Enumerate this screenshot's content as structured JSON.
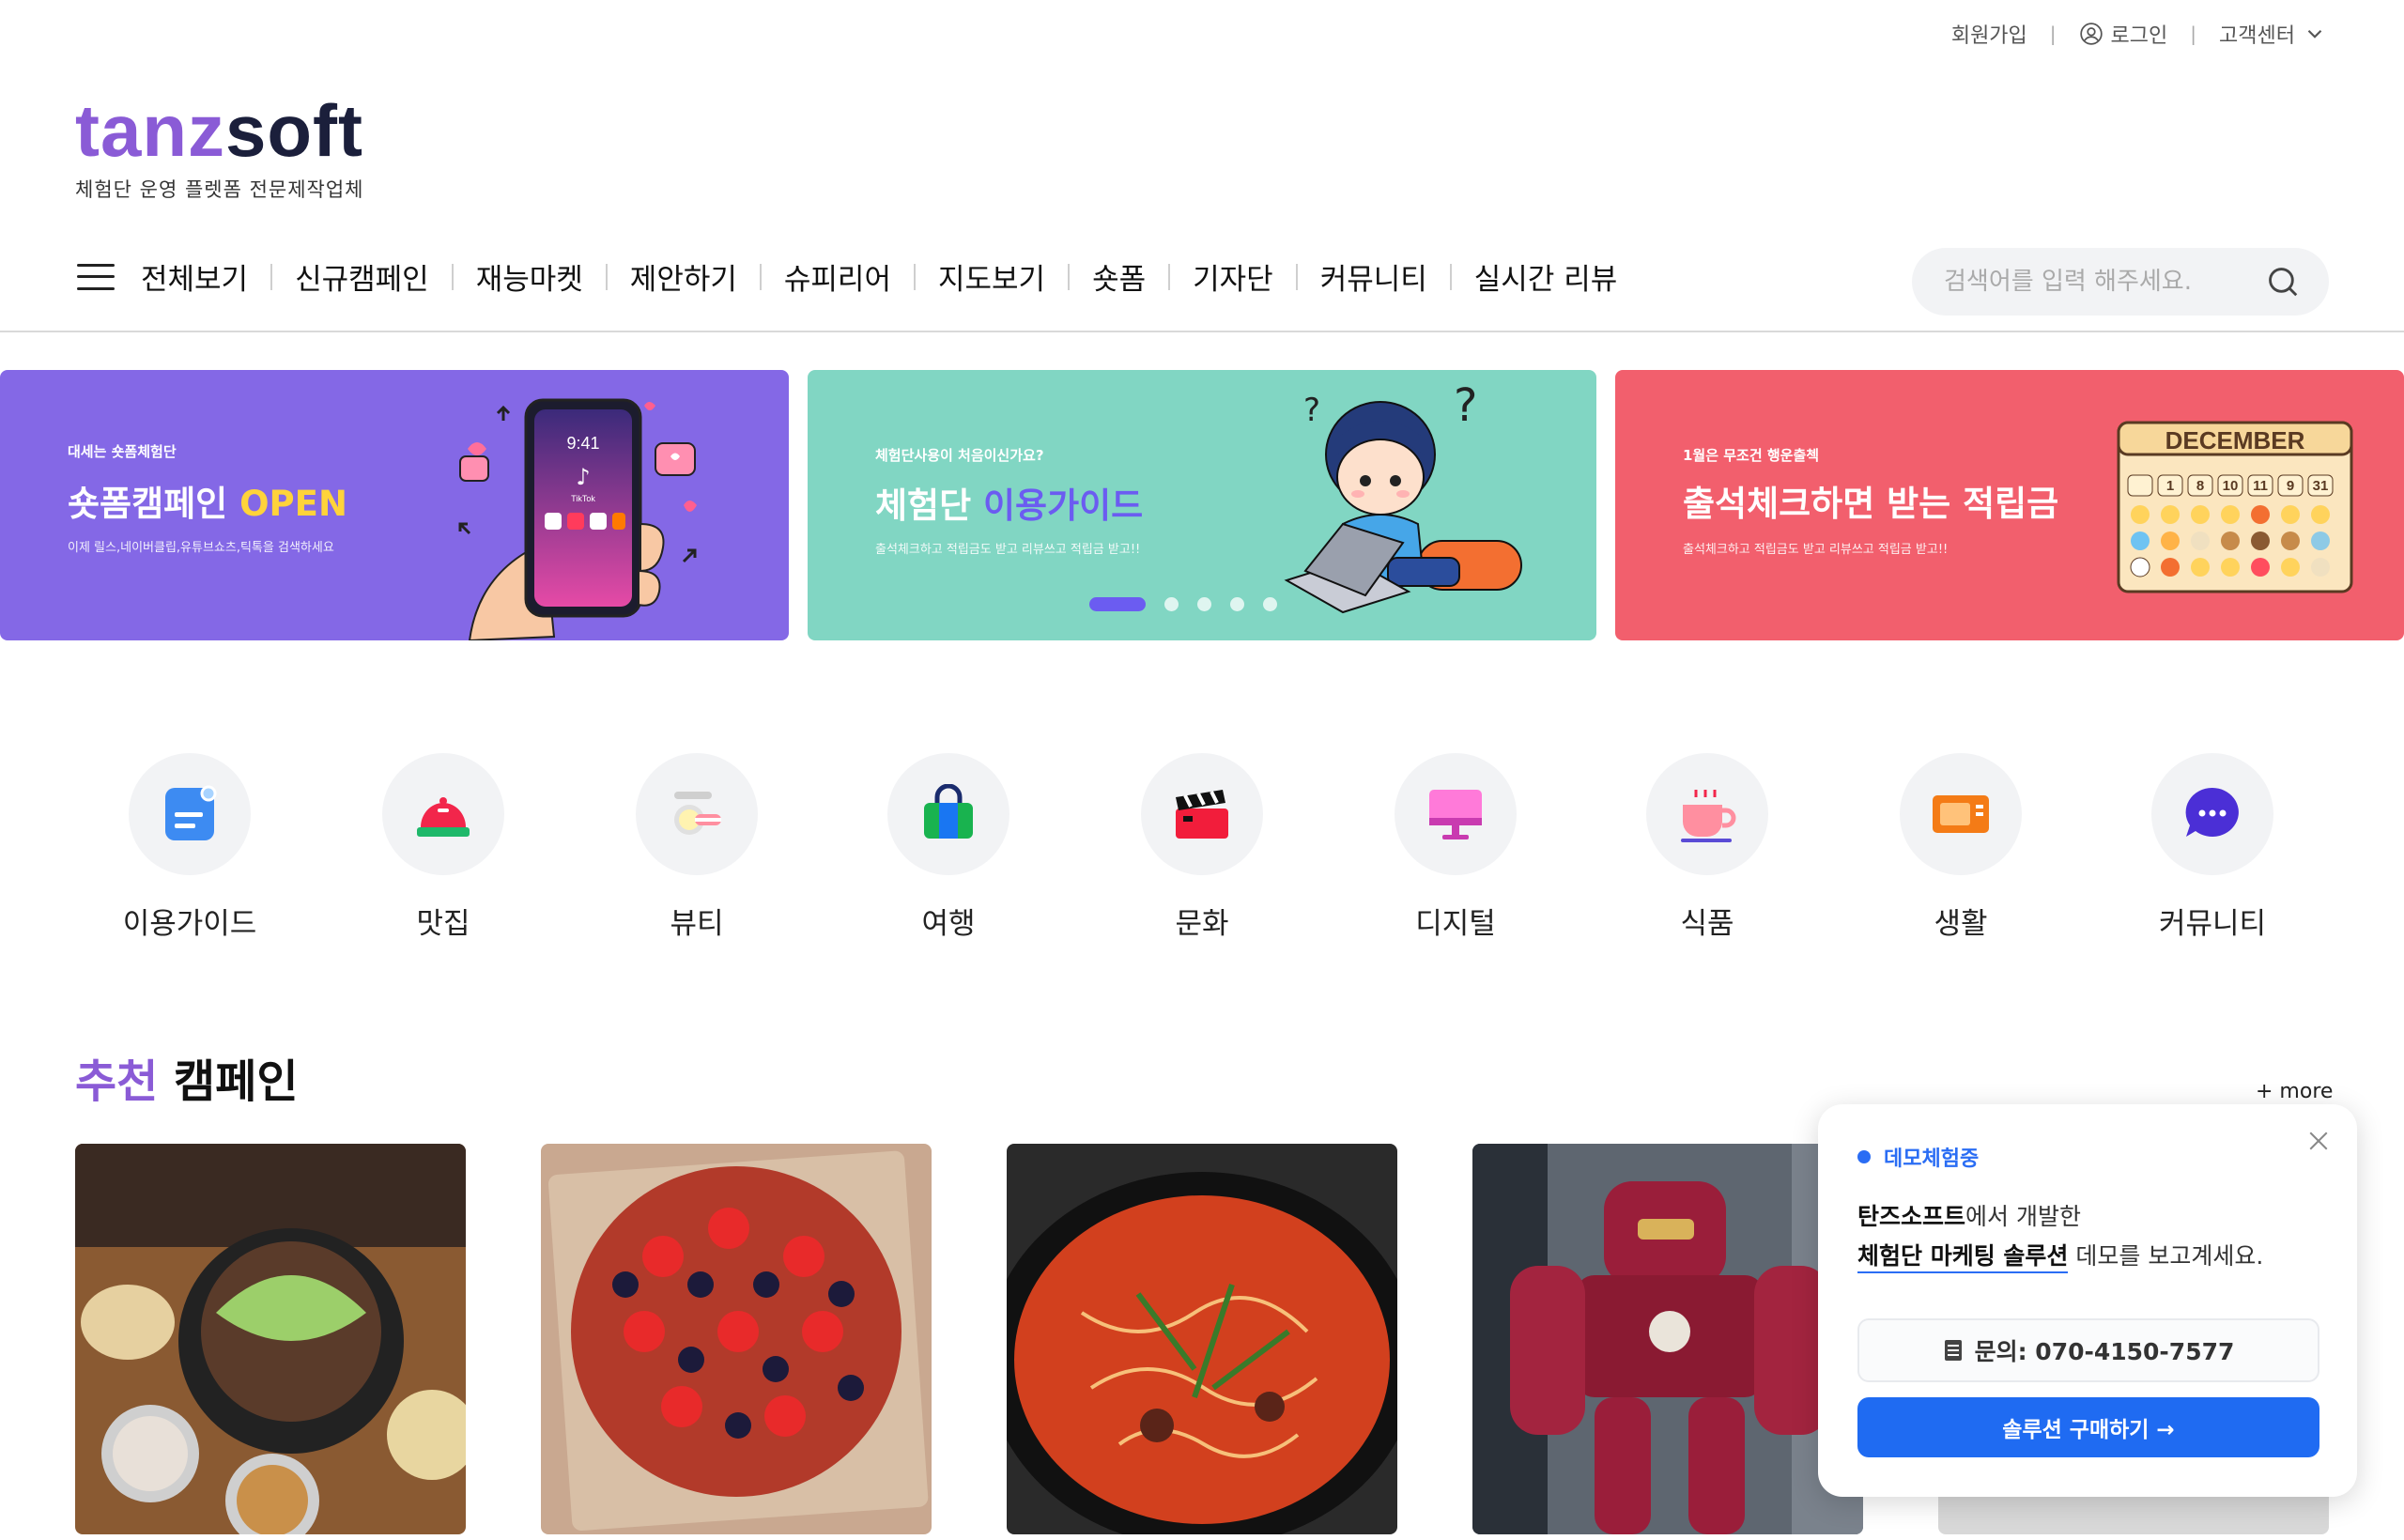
{
  "util": {
    "signup": "회원가입",
    "login": "로그인",
    "support": "고객센터"
  },
  "logo": {
    "part1": "tanz",
    "part2": "soft",
    "subtitle": "체험단 운영 플렛폼 전문제작업체"
  },
  "nav": {
    "items": [
      "전체보기",
      "신규캠페인",
      "재능마켓",
      "제안하기",
      "슈피리어",
      "지도보기",
      "숏폼",
      "기자단",
      "커뮤니티",
      "실시간 리뷰"
    ]
  },
  "search": {
    "placeholder": "검색어를 입력 해주세요."
  },
  "banners": [
    {
      "small": "대세는 숏폼체험단",
      "title": "숏폼캠페인 ",
      "title_accent": "OPEN",
      "desc": "이제 릴스,네이버클립,유튜브쇼츠,틱톡을 검색하세요",
      "phone_time": "9:41",
      "phone_app": "TikTok"
    },
    {
      "small": "체험단사용이 처음이신가요?",
      "title": "체험단 ",
      "title_accent": "이용가이드",
      "desc": "출석체크하고 적립금도 받고 리뷰쓰고 적립금 받고!!"
    },
    {
      "small": "1월은 무조건 행운출첵",
      "title": "출석체크하면 받는 적립금",
      "desc": "출석체크하고 적립금도 받고 리뷰쓰고 적립금 받고!!",
      "calendar_month": "DECEMBER",
      "calendar_nums": [
        "1",
        "8",
        "10",
        "11",
        "9",
        "31"
      ]
    }
  ],
  "slider": {
    "count": 5,
    "active": 1
  },
  "categories": [
    "이용가이드",
    "맛집",
    "뷰티",
    "여행",
    "문화",
    "디지털",
    "식품",
    "생활",
    "커뮤니티"
  ],
  "recommend": {
    "title_accent": "추천",
    "title_rest": " 캠페인",
    "more": "+ more"
  },
  "popup": {
    "badge": "데모체험중",
    "line1_bold": "탄즈소프트",
    "line1_rest": "에서 개발한",
    "line2_bold": "체험단 마케팅 솔루션",
    "line2_rest": " 데모를 보고계세요.",
    "contact": "문의: 070-4150-7577",
    "buy": "솔루션 구매하기 →"
  },
  "colors": {
    "brand_purple": "#8a5bd6",
    "banner1": "#8468e6",
    "banner2": "#81d6c3",
    "banner3": "#f25f6d",
    "primary_blue": "#1f6bf2"
  }
}
